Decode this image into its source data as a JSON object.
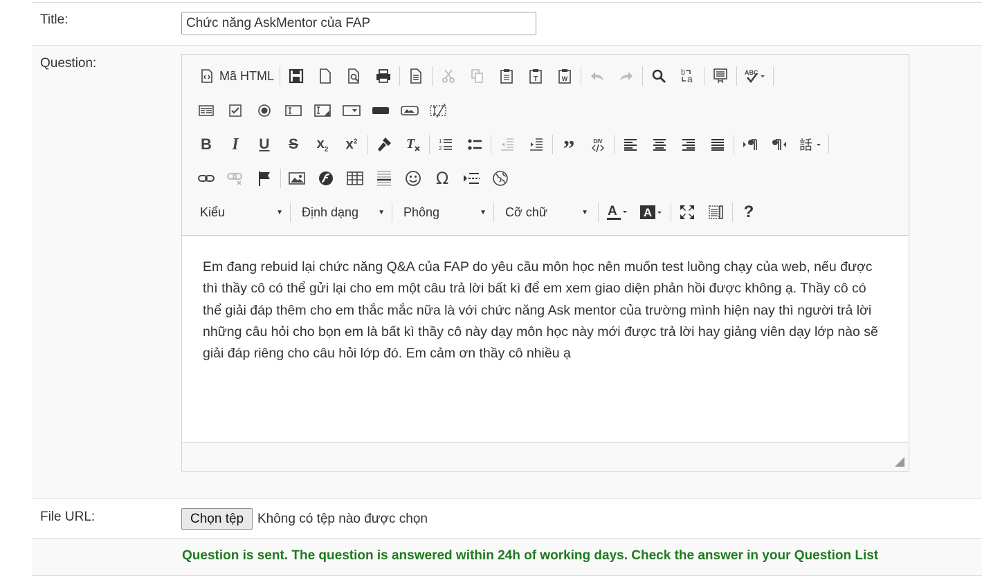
{
  "form": {
    "title_label": "Title:",
    "title_value": "Chức năng AskMentor của FAP",
    "question_label": "Question:",
    "file_label": "File URL:",
    "file_button": "Chọn tệp",
    "file_status": "Không có tệp nào được chọn",
    "success_message": "Question is sent. The question is answered within 24h of working days. Check the answer in your Question List",
    "success_color": "#1f7a1f"
  },
  "editor": {
    "source_button": "Mã HTML",
    "combos": {
      "styles": "Kiểu",
      "format": "Định dạng",
      "font": "Phông",
      "size": "Cỡ chữ"
    },
    "toolbar_icons": [
      [
        "source-icon",
        "save-icon",
        "new-page-icon",
        "preview-icon",
        "print-icon",
        "templates-icon",
        "cut-icon",
        "copy-icon",
        "paste-icon",
        "paste-text-icon",
        "paste-word-icon",
        "undo-icon",
        "redo-icon",
        "find-icon",
        "replace-icon",
        "select-all-icon",
        "spellcheck-icon"
      ],
      [
        "form-icon",
        "checkbox-icon",
        "radio-icon",
        "textfield-icon",
        "textarea-icon",
        "select-icon",
        "button-icon",
        "image-button-icon",
        "hidden-field-icon"
      ],
      [
        "bold-icon",
        "italic-icon",
        "underline-icon",
        "strike-icon",
        "subscript-icon",
        "superscript-icon",
        "copy-format-icon",
        "remove-format-icon",
        "numbered-list-icon",
        "bulleted-list-icon",
        "outdent-icon",
        "indent-icon",
        "blockquote-icon",
        "div-icon",
        "align-left-icon",
        "align-center-icon",
        "align-right-icon",
        "justify-icon",
        "ltr-icon",
        "rtl-icon",
        "language-icon"
      ],
      [
        "link-icon",
        "unlink-icon",
        "anchor-icon",
        "image-icon",
        "flash-icon",
        "table-icon",
        "horizontal-rule-icon",
        "smiley-icon",
        "special-char-icon",
        "page-break-icon",
        "iframe-icon"
      ],
      [
        "text-color-icon",
        "bg-color-icon",
        "maximize-icon",
        "show-blocks-icon",
        "about-icon"
      ]
    ],
    "content": "Em đang rebuid lại chức năng Q&A của FAP do yêu cầu môn học nên muốn test luồng chạy của web, nếu được thì thầy cô có thể gửi lại cho em một câu trả lời bất kì để em xem giao diện phản hồi được không ạ. Thầy cô có thể giải đáp thêm cho em thắc mắc nữa là với chức năng Ask mentor của trường mình hiện nay thì người trả lời những câu hỏi cho bọn em là bất kì thầy cô này dạy môn học này mới được trả lời hay giảng viên dạy lớp nào sẽ giải đáp riêng cho câu hỏi lớp đó. Em cảm ơn thầy cô nhiều ạ"
  }
}
